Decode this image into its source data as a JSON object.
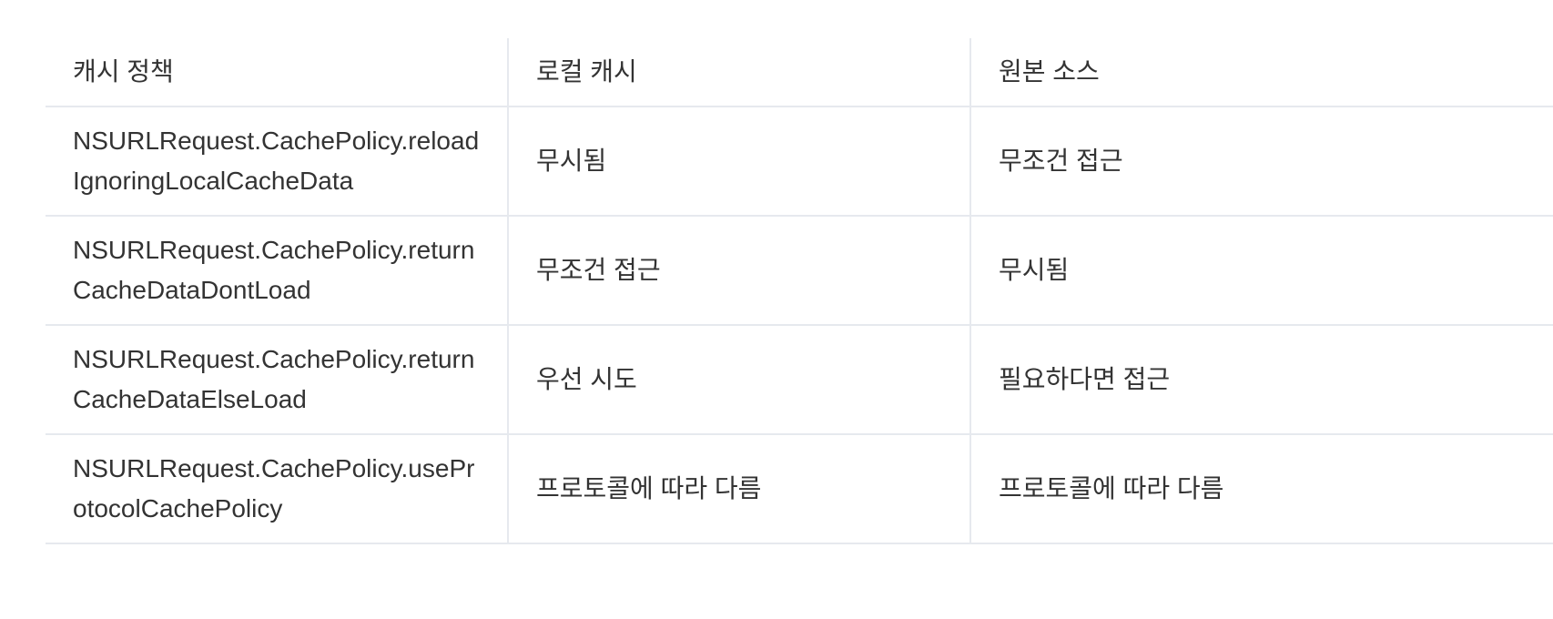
{
  "table": {
    "headers": [
      "캐시 정책",
      "로컬 캐시",
      "원본 소스"
    ],
    "rows": [
      [
        "NSURLRequest.CachePolicy.reloadIgnoringLocalCacheData",
        "무시됨",
        "무조건 접근"
      ],
      [
        "NSURLRequest.CachePolicy.returnCacheDataDontLoad",
        "무조건 접근",
        "무시됨"
      ],
      [
        "NSURLRequest.CachePolicy.returnCacheDataElseLoad",
        "우선 시도",
        "필요하다면 접근"
      ],
      [
        "NSURLRequest.CachePolicy.useProtocolCachePolicy",
        "프로토콜에 따라 다름",
        "프로토콜에 따라 다름"
      ]
    ]
  },
  "colors": {
    "text": "#333333",
    "border": "#e6e9ee",
    "background": "#ffffff"
  }
}
